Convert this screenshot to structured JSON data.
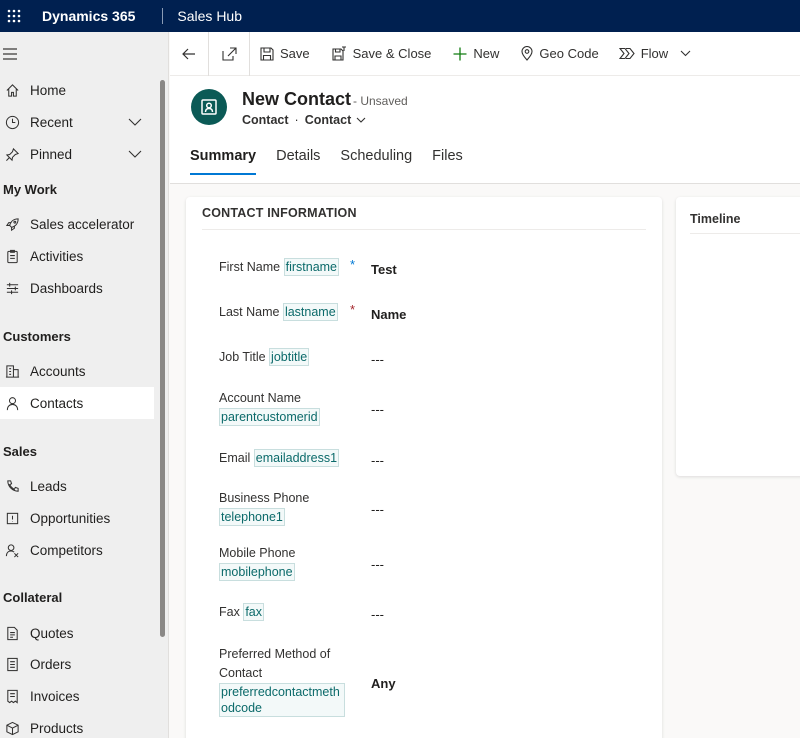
{
  "topbar": {
    "app_name": "Dynamics 365",
    "hub_name": "Sales Hub"
  },
  "sidebar": {
    "items": [
      {
        "label": "Home",
        "icon": "home-icon",
        "chevron": false
      },
      {
        "label": "Recent",
        "icon": "clock-icon",
        "chevron": true
      },
      {
        "label": "Pinned",
        "icon": "pin-icon",
        "chevron": true
      }
    ],
    "groups": [
      {
        "title": "My Work",
        "items": [
          {
            "label": "Sales accelerator"
          },
          {
            "label": "Activities"
          },
          {
            "label": "Dashboards"
          }
        ]
      },
      {
        "title": "Customers",
        "items": [
          {
            "label": "Accounts"
          },
          {
            "label": "Contacts",
            "selected": true
          }
        ]
      },
      {
        "title": "Sales",
        "items": [
          {
            "label": "Leads"
          },
          {
            "label": "Opportunities"
          },
          {
            "label": "Competitors"
          }
        ]
      },
      {
        "title": "Collateral",
        "items": [
          {
            "label": "Quotes"
          },
          {
            "label": "Orders"
          },
          {
            "label": "Invoices"
          },
          {
            "label": "Products"
          }
        ]
      }
    ]
  },
  "commands": {
    "save": "Save",
    "save_close": "Save & Close",
    "new": "New",
    "geo_code": "Geo Code",
    "flow": "Flow"
  },
  "header": {
    "title": "New Contact",
    "status": "- Unsaved",
    "entity": "Contact",
    "form": "Contact",
    "tabs": [
      "Summary",
      "Details",
      "Scheduling",
      "Files"
    ],
    "active_tab": "Summary"
  },
  "section": {
    "title": "CONTACT INFORMATION",
    "fields": [
      {
        "label": "First Name",
        "schema": "firstname",
        "value": "Test",
        "required": "*"
      },
      {
        "label": "Last Name",
        "schema": "lastname",
        "value": "Name",
        "required": "*"
      },
      {
        "label": "Job Title",
        "schema": "jobtitle",
        "value": "---"
      },
      {
        "label": "Account Name",
        "schema": "parentcustomerid",
        "value": "---"
      },
      {
        "label": "Email",
        "schema": "emailaddress1",
        "value": "---"
      },
      {
        "label": "Business Phone",
        "schema": "telephone1",
        "value": "---"
      },
      {
        "label": "Mobile Phone",
        "schema": "mobilephone",
        "value": "---"
      },
      {
        "label": "Fax",
        "schema": "fax",
        "value": "---"
      },
      {
        "label": "Preferred Method of Contact",
        "schema": "preferredcontactmethodcode",
        "value": "Any"
      }
    ]
  },
  "timeline": {
    "title": "Timeline"
  },
  "colors": {
    "topbar": "#002050",
    "accent": "#0078d4",
    "avatar": "#0b5a56",
    "required": "#a4262c",
    "schema_text": "#0b6a6a"
  }
}
